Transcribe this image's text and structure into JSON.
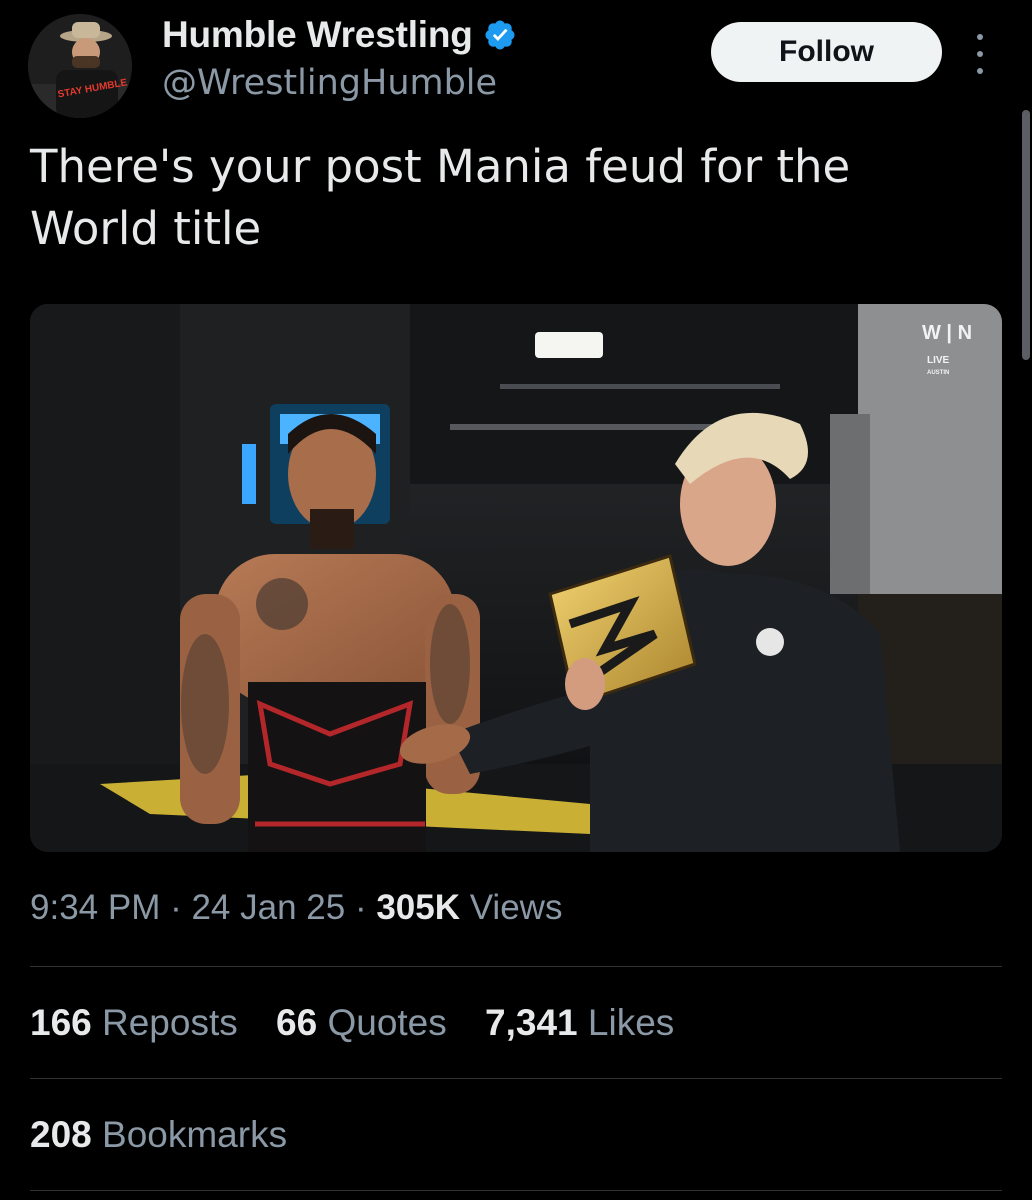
{
  "author": {
    "display_name": "Humble Wrestling",
    "handle": "@WrestlingHumble",
    "verified_icon": "verified-badge-icon",
    "avatar_text": "STAY HUMBLE"
  },
  "actions": {
    "follow_label": "Follow",
    "more_icon": "more-vertical-icon"
  },
  "tweet": {
    "text": "There's your post Mania feud for the World title"
  },
  "media": {
    "watermark_main": "W | N",
    "watermark_live": "LIVE",
    "watermark_city": "AUSTIN"
  },
  "meta": {
    "time": "9:34 PM",
    "separator": " · ",
    "date": "24 Jan 25",
    "views_count": "305K",
    "views_label": " Views"
  },
  "stats": {
    "reposts_count": "166",
    "reposts_label": " Reposts",
    "quotes_count": "66",
    "quotes_label": " Quotes",
    "likes_count": "7,341",
    "likes_label": " Likes",
    "bookmarks_count": "208",
    "bookmarks_label": " Bookmarks"
  },
  "colors": {
    "background": "#000000",
    "text_primary": "#e7e9ea",
    "text_secondary": "#8b98a5",
    "verified_blue": "#1d9bf0",
    "divider": "#2f3336"
  }
}
